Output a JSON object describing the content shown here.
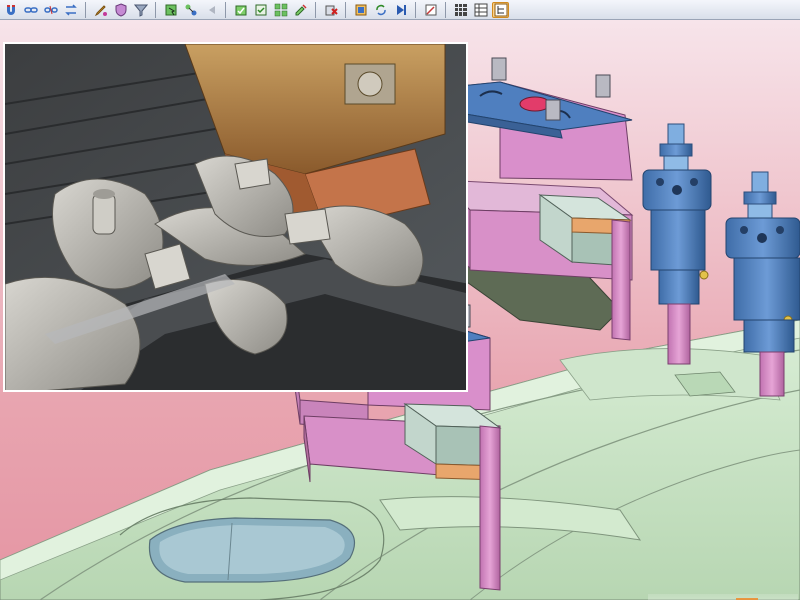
{
  "toolbar": {
    "groups": [
      [
        "magnet-icon",
        "link-icon",
        "link-broken-icon",
        "swap-icon"
      ],
      [
        "pencil-node-icon",
        "shield-icon",
        "funnel-icon"
      ],
      [
        "select-green-icon",
        "select-node-icon",
        "select-back-icon"
      ],
      [
        "edit-green-icon",
        "edit-check-icon",
        "grid-edit-icon",
        "edit-arrow-icon"
      ],
      [
        "delete-red-icon"
      ],
      [
        "crop-icon",
        "cycle-icon",
        "play-step-icon"
      ],
      [
        "sketch-edit-icon"
      ],
      [
        "grid-view-icon",
        "table-view-icon",
        "tree-view-icon"
      ]
    ],
    "active_button": "tree-view-icon"
  },
  "colors": {
    "background_top": "#f7e4ea",
    "background_bottom": "#e595a3",
    "die_green": "#c9e6c5",
    "block_pink": "#d37fc4",
    "plate_blue": "#4f7fbf",
    "insert_gray": "#b6ccc4",
    "insert_orange": "#e39c62",
    "photo_border": "#ffffff",
    "toolbar_active": "#fbd28b"
  }
}
